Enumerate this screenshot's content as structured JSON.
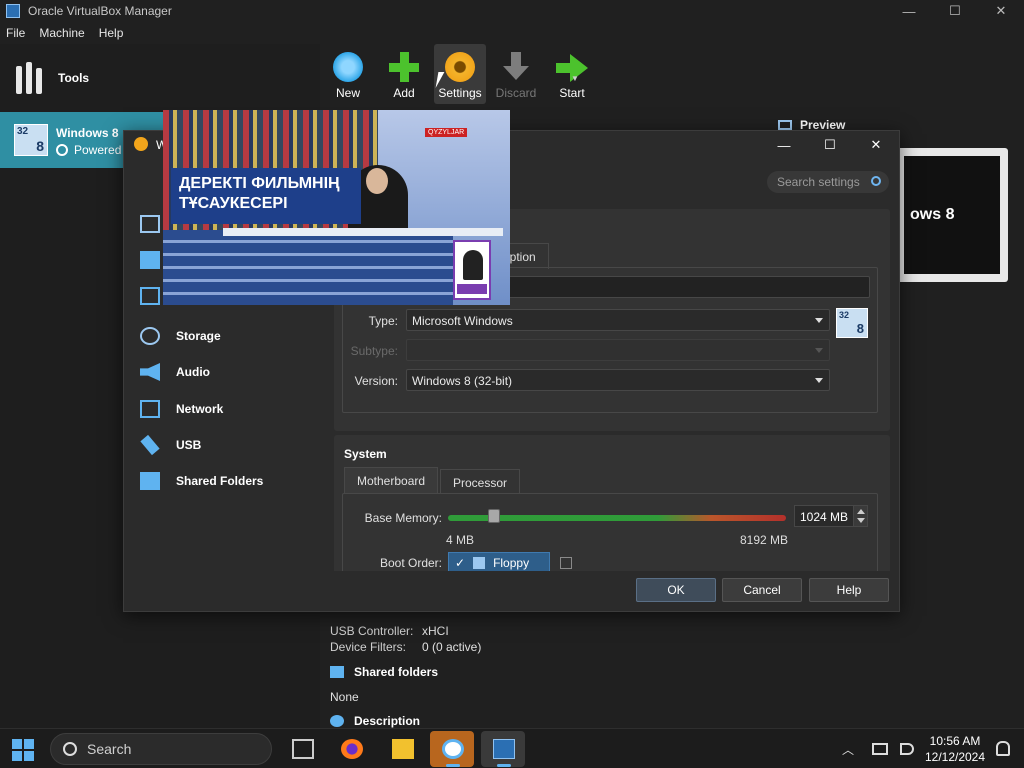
{
  "window": {
    "title": "Oracle VirtualBox Manager"
  },
  "menu": [
    "File",
    "Machine",
    "Help"
  ],
  "left": {
    "tools_label": "Tools",
    "vm_name": "Windows 8",
    "vm_state": "Powered"
  },
  "toolbar": {
    "new": "New",
    "add": "Add",
    "settings": "Settings",
    "discard": "Discard",
    "start": "Start"
  },
  "preview": {
    "label": "Preview",
    "screen_text": "ows 8"
  },
  "dialog": {
    "title": "W",
    "search_placeholder": "Search settings",
    "basic_tab": "Ba",
    "nav": [
      "Storage",
      "Audio",
      "Network",
      "USB",
      "Shared Folders"
    ],
    "tab_description": "cription",
    "type_label": "Type:",
    "type_value": "Microsoft Windows",
    "subtype_label": "Subtype:",
    "version_label": "Version:",
    "version_value": "Windows 8 (32-bit)",
    "os_badge_top": "32",
    "os_badge_bottom": "8",
    "system_title": "System",
    "tab_motherboard": "Motherboard",
    "tab_processor": "Processor",
    "base_memory_label": "Base Memory:",
    "base_memory_value": "1024 MB",
    "mem_min": "4 MB",
    "mem_max": "8192 MB",
    "boot_order_label": "Boot Order:",
    "boot_item": "Floppy",
    "ok": "OK",
    "cancel": "Cancel",
    "help": "Help"
  },
  "video": {
    "banner": "ДЕРЕКТІ ФИЛЬМНІҢ ТҰСАУКЕСЕРІ",
    "channel": "QYZYLJAR"
  },
  "details": {
    "usb_controller_label": "USB Controller:",
    "usb_controller_value": "xHCI",
    "device_filters_label": "Device Filters:",
    "device_filters_value": "0 (0 active)",
    "shared_folders": "Shared folders",
    "shared_none": "None",
    "description": "Description"
  },
  "taskbar": {
    "search": "Search",
    "time": "10:56 AM",
    "date": "12/12/2024"
  }
}
